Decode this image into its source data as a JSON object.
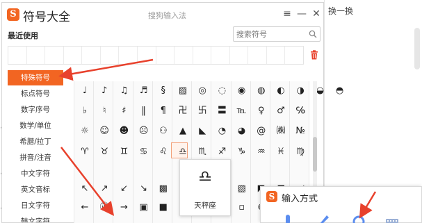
{
  "background": {
    "text": "换一换",
    "left_marks": [
      "↓",
      "•",
      "↑",
      "•",
      "•"
    ]
  },
  "dialog": {
    "title": "符号大全",
    "subtitle": "搜狗输入法",
    "logo": "S",
    "recent_label": "最近使用",
    "search_placeholder": "搜索符号",
    "controls": {
      "menu": "≡",
      "minimize": "—",
      "close": "✕"
    }
  },
  "categories": [
    {
      "label": "特殊符号",
      "active": true
    },
    {
      "label": "标点符号"
    },
    {
      "label": "数字序号"
    },
    {
      "label": "数学/单位"
    },
    {
      "label": "希腊/拉丁"
    },
    {
      "label": "拼音/注音"
    },
    {
      "label": "中文字符"
    },
    {
      "label": "英文音标"
    },
    {
      "label": "日文字符"
    },
    {
      "label": "韩文字符"
    }
  ],
  "symbol_rows": [
    [
      "♩",
      "♪",
      "♫",
      "♬",
      "§",
      "▨",
      "◎",
      "◌",
      "◉",
      "◍",
      "◐",
      "◑",
      "◒",
      "◓"
    ],
    [
      "♭",
      "♮",
      "♯",
      "‖",
      "¶",
      "卍",
      "卐",
      "〓",
      "℡",
      "♀",
      "♂",
      "℅"
    ],
    [
      "☼",
      "☺",
      "☻",
      "☹",
      "⚇",
      "▲",
      "◣",
      "◔",
      "◕",
      "@",
      "㈱",
      "№"
    ],
    [
      "♈",
      "♉",
      "♊",
      "♋",
      "♌",
      "♎",
      "♏",
      "♐",
      "♑",
      "♒",
      "♓",
      "♍"
    ],
    [
      "↖",
      "↗",
      "↙",
      "↘",
      "▩",
      "▤",
      "▥",
      "▦",
      "▧",
      "◤",
      "◥",
      "◢"
    ],
    [
      "←",
      "㊣",
      "→",
      "▣",
      "■",
      "□",
      "▢",
      "▪",
      "▫",
      "⊕",
      "⊗",
      "⊙"
    ]
  ],
  "preview": {
    "symbol": "♎",
    "name": "天秤座"
  },
  "ime_popup": {
    "logo": "S",
    "title": "输入方式",
    "icons": [
      "microphone-icon",
      "pen-icon",
      "circle-icon",
      "keyboard-icon"
    ]
  },
  "colors": {
    "accent": "#f26522",
    "arrow": "#e8412c"
  }
}
